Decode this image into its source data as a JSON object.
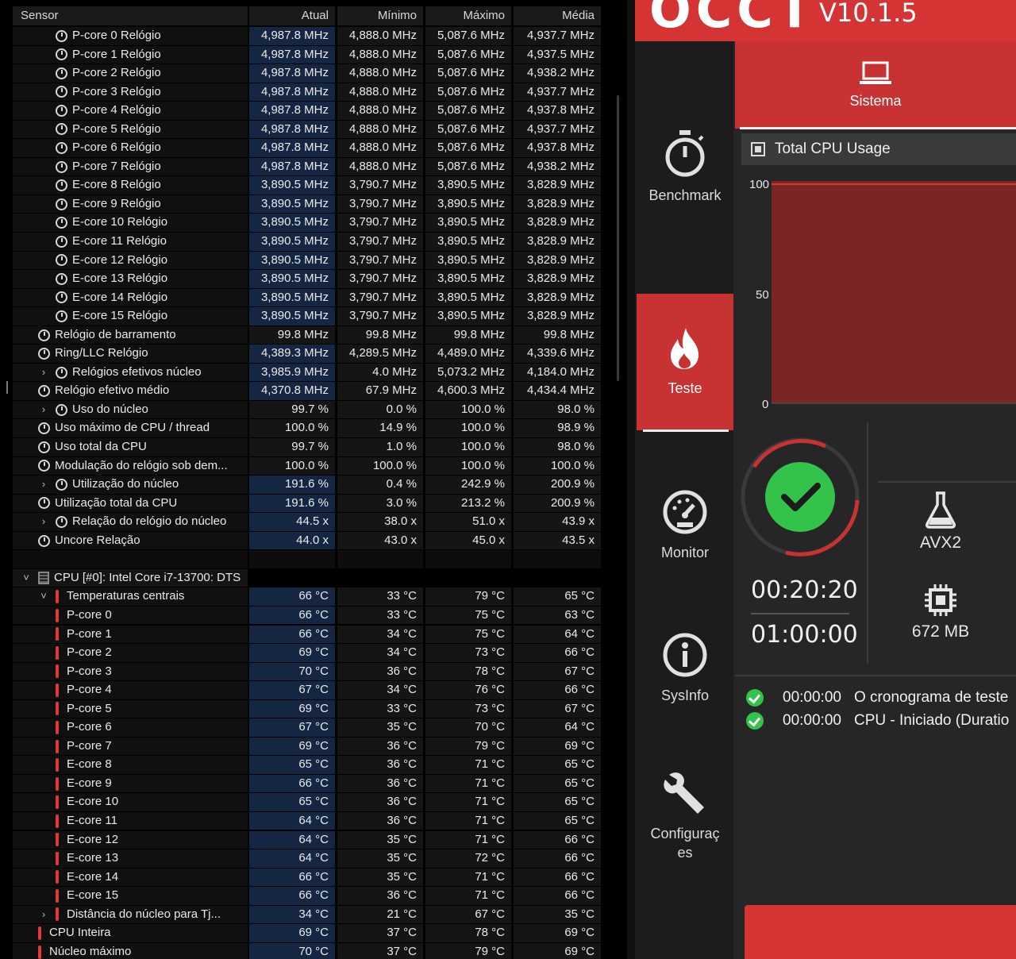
{
  "table": {
    "columns": {
      "sensor": "Sensor",
      "atual": "Atual",
      "min": "Mínimo",
      "max": "Máximo",
      "avg": "Média"
    },
    "rows": [
      {
        "label": "P-core 0 Relógio",
        "icon": "clock",
        "indent": 2,
        "atual": "4,987.8 MHz",
        "min": "4,888.0 MHz",
        "max": "5,087.6 MHz",
        "avg": "4,937.7 MHz",
        "hl": true
      },
      {
        "label": "P-core 1 Relógio",
        "icon": "clock",
        "indent": 2,
        "atual": "4,987.8 MHz",
        "min": "4,888.0 MHz",
        "max": "5,087.6 MHz",
        "avg": "4,937.5 MHz",
        "hl": true
      },
      {
        "label": "P-core 2 Relógio",
        "icon": "clock",
        "indent": 2,
        "atual": "4,987.8 MHz",
        "min": "4,888.0 MHz",
        "max": "5,087.6 MHz",
        "avg": "4,938.2 MHz",
        "hl": true
      },
      {
        "label": "P-core 3 Relógio",
        "icon": "clock",
        "indent": 2,
        "atual": "4,987.8 MHz",
        "min": "4,888.0 MHz",
        "max": "5,087.6 MHz",
        "avg": "4,937.7 MHz",
        "hl": true
      },
      {
        "label": "P-core 4 Relógio",
        "icon": "clock",
        "indent": 2,
        "atual": "4,987.8 MHz",
        "min": "4,888.0 MHz",
        "max": "5,087.6 MHz",
        "avg": "4,937.8 MHz",
        "hl": true
      },
      {
        "label": "P-core 5 Relógio",
        "icon": "clock",
        "indent": 2,
        "atual": "4,987.8 MHz",
        "min": "4,888.0 MHz",
        "max": "5,087.6 MHz",
        "avg": "4,937.7 MHz",
        "hl": true
      },
      {
        "label": "P-core 6 Relógio",
        "icon": "clock",
        "indent": 2,
        "atual": "4,987.8 MHz",
        "min": "4,888.0 MHz",
        "max": "5,087.6 MHz",
        "avg": "4,937.8 MHz",
        "hl": true
      },
      {
        "label": "P-core 7 Relógio",
        "icon": "clock",
        "indent": 2,
        "atual": "4,987.8 MHz",
        "min": "4,888.0 MHz",
        "max": "5,087.6 MHz",
        "avg": "4,938.2 MHz",
        "hl": true
      },
      {
        "label": "E-core 8 Relógio",
        "icon": "clock",
        "indent": 2,
        "atual": "3,890.5 MHz",
        "min": "3,790.7 MHz",
        "max": "3,890.5 MHz",
        "avg": "3,828.9 MHz",
        "hl": true
      },
      {
        "label": "E-core 9 Relógio",
        "icon": "clock",
        "indent": 2,
        "atual": "3,890.5 MHz",
        "min": "3,790.7 MHz",
        "max": "3,890.5 MHz",
        "avg": "3,828.9 MHz",
        "hl": true
      },
      {
        "label": "E-core 10 Relógio",
        "icon": "clock",
        "indent": 2,
        "atual": "3,890.5 MHz",
        "min": "3,790.7 MHz",
        "max": "3,890.5 MHz",
        "avg": "3,828.9 MHz",
        "hl": true
      },
      {
        "label": "E-core 11 Relógio",
        "icon": "clock",
        "indent": 2,
        "atual": "3,890.5 MHz",
        "min": "3,790.7 MHz",
        "max": "3,890.5 MHz",
        "avg": "3,828.9 MHz",
        "hl": true
      },
      {
        "label": "E-core 12 Relógio",
        "icon": "clock",
        "indent": 2,
        "atual": "3,890.5 MHz",
        "min": "3,790.7 MHz",
        "max": "3,890.5 MHz",
        "avg": "3,828.9 MHz",
        "hl": true
      },
      {
        "label": "E-core 13 Relógio",
        "icon": "clock",
        "indent": 2,
        "atual": "3,890.5 MHz",
        "min": "3,790.7 MHz",
        "max": "3,890.5 MHz",
        "avg": "3,828.9 MHz",
        "hl": true
      },
      {
        "label": "E-core 14 Relógio",
        "icon": "clock",
        "indent": 2,
        "atual": "3,890.5 MHz",
        "min": "3,790.7 MHz",
        "max": "3,890.5 MHz",
        "avg": "3,828.9 MHz",
        "hl": true
      },
      {
        "label": "E-core 15 Relógio",
        "icon": "clock",
        "indent": 2,
        "atual": "3,890.5 MHz",
        "min": "3,790.7 MHz",
        "max": "3,890.5 MHz",
        "avg": "3,828.9 MHz",
        "hl": true
      },
      {
        "label": "Relógio de barramento",
        "icon": "clock",
        "indent": 1,
        "atual": "99.8 MHz",
        "min": "99.8 MHz",
        "max": "99.8 MHz",
        "avg": "99.8 MHz",
        "hl": false
      },
      {
        "label": "Ring/LLC Relógio",
        "icon": "clock",
        "indent": 1,
        "atual": "4,389.3 MHz",
        "min": "4,289.5 MHz",
        "max": "4,489.0 MHz",
        "avg": "4,339.6 MHz",
        "hl": true
      },
      {
        "label": "Relógios efetivos núcleo",
        "icon": "clock",
        "indent": 2,
        "expand": "›",
        "atual": "3,985.9 MHz",
        "min": "4.0 MHz",
        "max": "5,073.2 MHz",
        "avg": "4,184.0 MHz",
        "hl": true
      },
      {
        "label": "Relógio efetivo médio",
        "icon": "clock",
        "indent": 1,
        "atual": "4,370.8 MHz",
        "min": "67.9 MHz",
        "max": "4,600.3 MHz",
        "avg": "4,434.4 MHz",
        "hl": true
      },
      {
        "label": "Uso do núcleo",
        "icon": "clock",
        "indent": 2,
        "expand": "›",
        "atual": "99.7 %",
        "min": "0.0 %",
        "max": "100.0 %",
        "avg": "98.0 %",
        "hl": false
      },
      {
        "label": "Uso máximo de CPU / thread",
        "icon": "clock",
        "indent": 1,
        "atual": "100.0 %",
        "min": "14.9 %",
        "max": "100.0 %",
        "avg": "98.9 %",
        "hl": false
      },
      {
        "label": "Uso total da CPU",
        "icon": "clock",
        "indent": 1,
        "atual": "99.7 %",
        "min": "1.0 %",
        "max": "100.0 %",
        "avg": "98.0 %",
        "hl": false
      },
      {
        "label": "Modulação do relógio sob dem...",
        "icon": "clock",
        "indent": 1,
        "atual": "100.0 %",
        "min": "100.0 %",
        "max": "100.0 %",
        "avg": "100.0 %",
        "hl": false
      },
      {
        "label": "Utilização do núcleo",
        "icon": "clock",
        "indent": 2,
        "expand": "›",
        "atual": "191.6 %",
        "min": "0.4 %",
        "max": "242.9 %",
        "avg": "200.9 %",
        "hl": true
      },
      {
        "label": "Utilização total da CPU",
        "icon": "clock",
        "indent": 1,
        "atual": "191.6 %",
        "min": "3.0 %",
        "max": "213.2 %",
        "avg": "200.9 %",
        "hl": true
      },
      {
        "label": "Relação do relógio do núcleo",
        "icon": "clock",
        "indent": 2,
        "expand": "›",
        "atual": "44.5 x",
        "min": "38.0 x",
        "max": "51.0 x",
        "avg": "43.9 x",
        "hl": true
      },
      {
        "label": "Uncore Relação",
        "icon": "clock",
        "indent": 1,
        "atual": "44.0 x",
        "min": "43.0 x",
        "max": "45.0 x",
        "avg": "43.5 x",
        "hl": true
      },
      {
        "blank": true
      },
      {
        "label": "CPU [#0]: Intel Core i7-13700: DTS",
        "icon": "chip",
        "indent": 1,
        "expand": "˅",
        "group": true
      },
      {
        "label": "Temperaturas centrais",
        "icon": "therm",
        "indent": 2,
        "expand": "˅",
        "atual": "66 °C",
        "min": "33 °C",
        "max": "79 °C",
        "avg": "65 °C",
        "hl": true
      },
      {
        "label": "P-core 0",
        "icon": "therm",
        "indent": 2,
        "atual": "66 °C",
        "min": "33 °C",
        "max": "75 °C",
        "avg": "63 °C",
        "hl": true
      },
      {
        "label": "P-core 1",
        "icon": "therm",
        "indent": 2,
        "atual": "66 °C",
        "min": "34 °C",
        "max": "75 °C",
        "avg": "64 °C",
        "hl": true
      },
      {
        "label": "P-core 2",
        "icon": "therm",
        "indent": 2,
        "atual": "69 °C",
        "min": "34 °C",
        "max": "73 °C",
        "avg": "66 °C",
        "hl": true
      },
      {
        "label": "P-core 3",
        "icon": "therm",
        "indent": 2,
        "atual": "70 °C",
        "min": "36 °C",
        "max": "78 °C",
        "avg": "67 °C",
        "hl": true
      },
      {
        "label": "P-core 4",
        "icon": "therm",
        "indent": 2,
        "atual": "67 °C",
        "min": "34 °C",
        "max": "76 °C",
        "avg": "66 °C",
        "hl": true
      },
      {
        "label": "P-core 5",
        "icon": "therm",
        "indent": 2,
        "atual": "69 °C",
        "min": "33 °C",
        "max": "73 °C",
        "avg": "67 °C",
        "hl": true
      },
      {
        "label": "P-core 6",
        "icon": "therm",
        "indent": 2,
        "atual": "67 °C",
        "min": "35 °C",
        "max": "70 °C",
        "avg": "64 °C",
        "hl": true
      },
      {
        "label": "P-core 7",
        "icon": "therm",
        "indent": 2,
        "atual": "69 °C",
        "min": "36 °C",
        "max": "79 °C",
        "avg": "69 °C",
        "hl": true
      },
      {
        "label": "E-core 8",
        "icon": "therm",
        "indent": 2,
        "atual": "65 °C",
        "min": "36 °C",
        "max": "71 °C",
        "avg": "65 °C",
        "hl": true
      },
      {
        "label": "E-core 9",
        "icon": "therm",
        "indent": 2,
        "atual": "66 °C",
        "min": "36 °C",
        "max": "71 °C",
        "avg": "65 °C",
        "hl": true
      },
      {
        "label": "E-core 10",
        "icon": "therm",
        "indent": 2,
        "atual": "65 °C",
        "min": "36 °C",
        "max": "71 °C",
        "avg": "65 °C",
        "hl": true
      },
      {
        "label": "E-core 11",
        "icon": "therm",
        "indent": 2,
        "atual": "64 °C",
        "min": "36 °C",
        "max": "71 °C",
        "avg": "65 °C",
        "hl": true
      },
      {
        "label": "E-core 12",
        "icon": "therm",
        "indent": 2,
        "atual": "64 °C",
        "min": "35 °C",
        "max": "71 °C",
        "avg": "66 °C",
        "hl": true
      },
      {
        "label": "E-core 13",
        "icon": "therm",
        "indent": 2,
        "atual": "64 °C",
        "min": "35 °C",
        "max": "72 °C",
        "avg": "66 °C",
        "hl": true
      },
      {
        "label": "E-core 14",
        "icon": "therm",
        "indent": 2,
        "atual": "66 °C",
        "min": "35 °C",
        "max": "71 °C",
        "avg": "66 °C",
        "hl": true
      },
      {
        "label": "E-core 15",
        "icon": "therm",
        "indent": 2,
        "atual": "66 °C",
        "min": "36 °C",
        "max": "71 °C",
        "avg": "66 °C",
        "hl": true
      },
      {
        "label": "Distância do núcleo para Tj...",
        "icon": "therm",
        "indent": 2,
        "expand": "›",
        "atual": "34 °C",
        "min": "21 °C",
        "max": "67 °C",
        "avg": "35 °C",
        "hl": true
      },
      {
        "label": "CPU Inteira",
        "icon": "therm",
        "indent": 1,
        "atual": "69 °C",
        "min": "37 °C",
        "max": "78 °C",
        "avg": "69 °C",
        "hl": true
      },
      {
        "label": "Núcleo máximo",
        "icon": "therm",
        "indent": 1,
        "atual": "70 °C",
        "min": "37 °C",
        "max": "79 °C",
        "avg": "69 °C",
        "hl": true
      }
    ]
  },
  "occt": {
    "logo": "OCCT",
    "version": "V10.1.5",
    "nav": {
      "benchmark": "Benchmark",
      "teste": "Teste",
      "monitor": "Monitor",
      "sysinfo": "SysInfo",
      "config_line1": "Configuraç",
      "config_line2": "es"
    },
    "tab_sistema": "Sistema",
    "usage_title": "Total CPU Usage",
    "chart_yticks": [
      "100",
      "50",
      "0"
    ],
    "elapsed": "00:20:20",
    "total": "01:00:00",
    "stat_mode": "AVX2",
    "stat_memory": "672 MB",
    "log": [
      {
        "time": "00:00:00",
        "text": "O cronograma de teste"
      },
      {
        "time": "00:00:00",
        "text": "CPU - Iniciado (Duratio"
      }
    ],
    "colors": {
      "accent": "#d43434",
      "ok": "#33c24a",
      "ring": "#c93232"
    }
  }
}
